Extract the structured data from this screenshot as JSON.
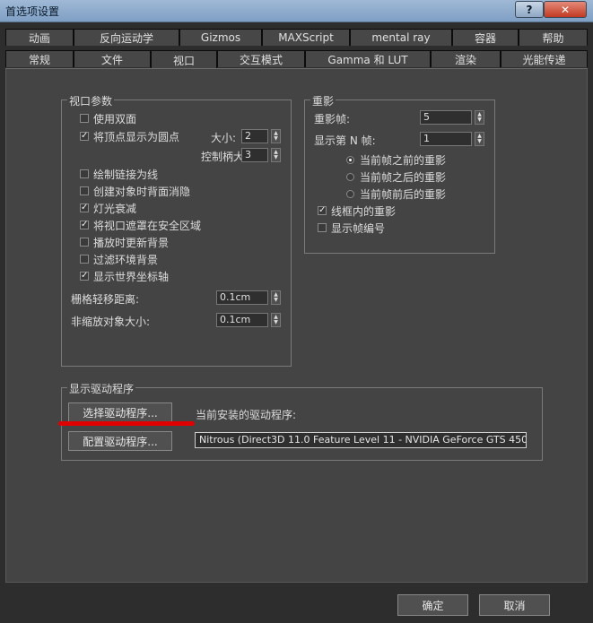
{
  "window": {
    "title": "首选项设置",
    "help_label": "?",
    "close_label": "✕"
  },
  "tabs_row1": [
    "动画",
    "反向运动学",
    "Gizmos",
    "MAXScript",
    "mental ray",
    "容器",
    "帮助"
  ],
  "tabs_row2": [
    "常规",
    "文件",
    "视口",
    "交互模式",
    "Gamma 和 LUT",
    "渲染",
    "光能传递"
  ],
  "active_tab": "视口",
  "viewport_params": {
    "title": "视口参数",
    "use_dual_planes": "使用双面",
    "show_vertices_as_dots": "将顶点显示为圆点",
    "size_label": "大小:",
    "size_value": "2",
    "handle_size_label": "控制柄大小:",
    "handle_size_value": "3",
    "draw_links_as_lines": "绘制链接为线",
    "backface_cull": "创建对象时背面消隐",
    "attenuate_lights": "灯光衰减",
    "mask_safe_region": "将视口遮罩在安全区域",
    "update_bg_on_play": "播放时更新背景",
    "filter_env_bg": "过滤环境背景",
    "show_world_axis": "显示世界坐标轴",
    "grid_nudge_label": "栅格轻移距离:",
    "grid_nudge_value": "0.1cm",
    "non_scaling_label": "非缩放对象大小:",
    "non_scaling_value": "0.1cm"
  },
  "ghosting": {
    "title": "重影",
    "ghost_frames_label": "重影帧:",
    "ghost_frames_value": "5",
    "every_nth_label": "显示第 N 帧:",
    "every_nth_value": "1",
    "before_current": "当前帧之前的重影",
    "after_current": "当前帧之后的重影",
    "before_after": "当前帧前后的重影",
    "wireframe_ghost": "线框内的重影",
    "show_frame_numbers": "显示帧编号"
  },
  "display_driver": {
    "title": "显示驱动程序",
    "choose_driver": "选择驱动程序...",
    "installed_label": "当前安装的驱动程序:",
    "configure_driver": "配置驱动程序...",
    "driver_name": "Nitrous (Direct3D 11.0 Feature Level 11 - NVIDIA GeForce GTS 450"
  },
  "footer": {
    "ok": "确定",
    "cancel": "取消"
  },
  "colors": {
    "background": "#444444",
    "highlight_underline": "#e00000"
  }
}
